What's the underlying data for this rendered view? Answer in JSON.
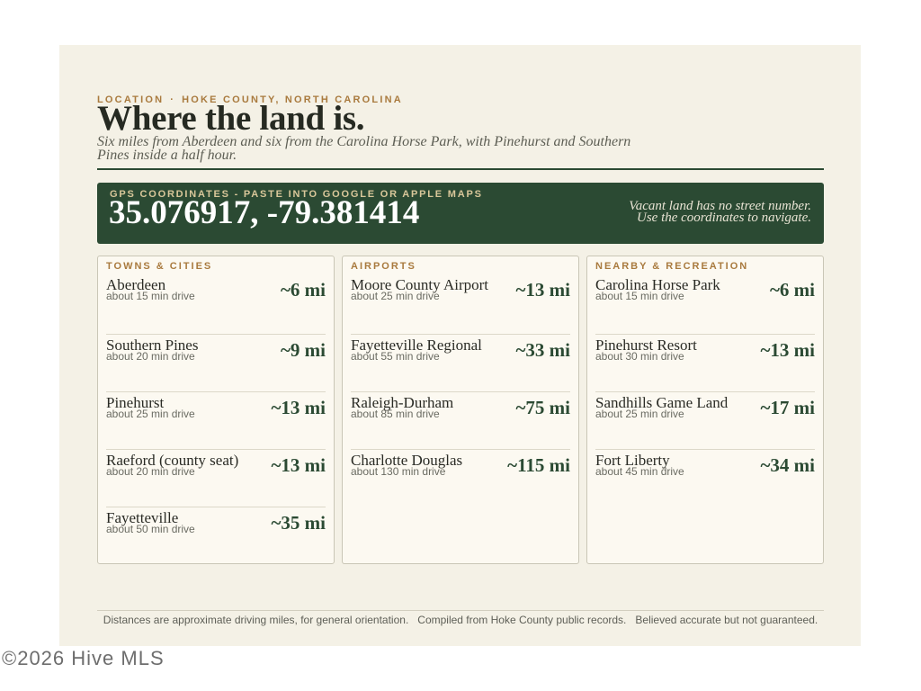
{
  "header": {
    "eyebrow_left": "LOCATION",
    "eyebrow_sep": "·",
    "eyebrow_right": "HOKE COUNTY, NORTH CAROLINA",
    "title": "Where the land is.",
    "subtitle": "Six miles from Aberdeen and six from the Carolina Horse Park, with Pinehurst and Southern Pines inside a half hour."
  },
  "gps": {
    "label": "GPS COORDINATES - PASTE INTO GOOGLE OR APPLE MAPS",
    "coordinates": "35.076917, -79.381414",
    "note_line1": "Vacant land has no street number.",
    "note_line2": "Use the coordinates to navigate."
  },
  "cards": [
    {
      "title": "TOWNS & CITIES",
      "items": [
        {
          "name": "Aberdeen",
          "sub": "about 15 min drive",
          "dist": "~6 mi"
        },
        {
          "name": "Southern Pines",
          "sub": "about 20 min drive",
          "dist": "~9 mi"
        },
        {
          "name": "Pinehurst",
          "sub": "about 25 min drive",
          "dist": "~13 mi"
        },
        {
          "name": "Raeford (county seat)",
          "sub": "about 20 min drive",
          "dist": "~13 mi"
        },
        {
          "name": "Fayetteville",
          "sub": "about 50 min drive",
          "dist": "~35 mi"
        }
      ]
    },
    {
      "title": "AIRPORTS",
      "items": [
        {
          "name": "Moore County Airport",
          "sub": "about 25 min drive",
          "dist": "~13 mi"
        },
        {
          "name": "Fayetteville Regional",
          "sub": "about 55 min drive",
          "dist": "~33 mi"
        },
        {
          "name": "Raleigh-Durham",
          "sub": "about 85 min drive",
          "dist": "~75 mi"
        },
        {
          "name": "Charlotte Douglas",
          "sub": "about 130 min drive",
          "dist": "~115 mi"
        }
      ]
    },
    {
      "title": "NEARBY & RECREATION",
      "items": [
        {
          "name": "Carolina Horse Park",
          "sub": "about 15 min drive",
          "dist": "~6 mi"
        },
        {
          "name": "Pinehurst Resort",
          "sub": "about 30 min drive",
          "dist": "~13 mi"
        },
        {
          "name": "Sandhills Game Land",
          "sub": "about 25 min drive",
          "dist": "~17 mi"
        },
        {
          "name": "Fort Liberty",
          "sub": "about 45 min drive",
          "dist": "~34 mi"
        }
      ]
    }
  ],
  "footer": {
    "part1": "Distances are approximate driving miles, for general orientation.",
    "part2": "Compiled from Hoke County public records.",
    "part3": "Believed accurate but not guaranteed."
  },
  "watermark": "©2026 Hive MLS"
}
